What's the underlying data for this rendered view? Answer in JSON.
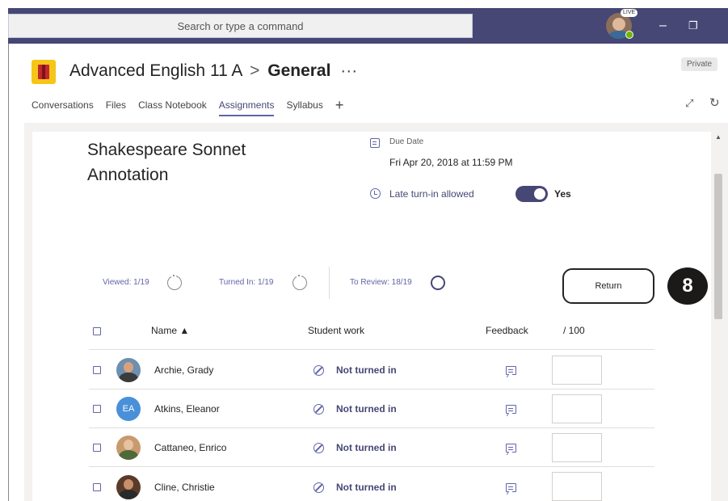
{
  "titlebar": {
    "search_placeholder": "Search or type a command",
    "user_badge": "LIVE",
    "minimize": "–",
    "restore": "❐"
  },
  "header": {
    "team": "Advanced English 11 A",
    "separator": ">",
    "channel": "General",
    "more": "···",
    "private_label": "Private"
  },
  "tabs": [
    "Conversations",
    "Files",
    "Class Notebook",
    "Assignments",
    "Syllabus"
  ],
  "tab_add": "+",
  "assignment": {
    "title": "Shakespeare Sonnet Annotation",
    "due_label": "Due Date",
    "due_value": "Fri Apr 20, 2018 at 11:59 PM",
    "late_label": "Late turn-in allowed",
    "late_value": "Yes"
  },
  "stats": {
    "viewed": "Viewed: 1/19",
    "turned_in": "Turned In: 1/19",
    "to_review": "To Review: 18/19"
  },
  "return_button": "Return",
  "callout": "8",
  "table": {
    "headers": {
      "name": "Name ▲",
      "student_work": "Student work",
      "feedback": "Feedback",
      "points": "/ 100"
    },
    "rows": [
      {
        "name": "Archie, Grady",
        "status": "Not turned in",
        "avatar": "photo"
      },
      {
        "name": "Atkins, Eleanor",
        "status": "Not turned in",
        "avatar": "EA"
      },
      {
        "name": "Cattaneo, Enrico",
        "status": "Not turned in",
        "avatar": "photo"
      },
      {
        "name": "Cline, Christie",
        "status": "Not turned in",
        "avatar": "photo"
      }
    ]
  },
  "colors": {
    "brand": "#464775",
    "accent": "#6264a7"
  }
}
